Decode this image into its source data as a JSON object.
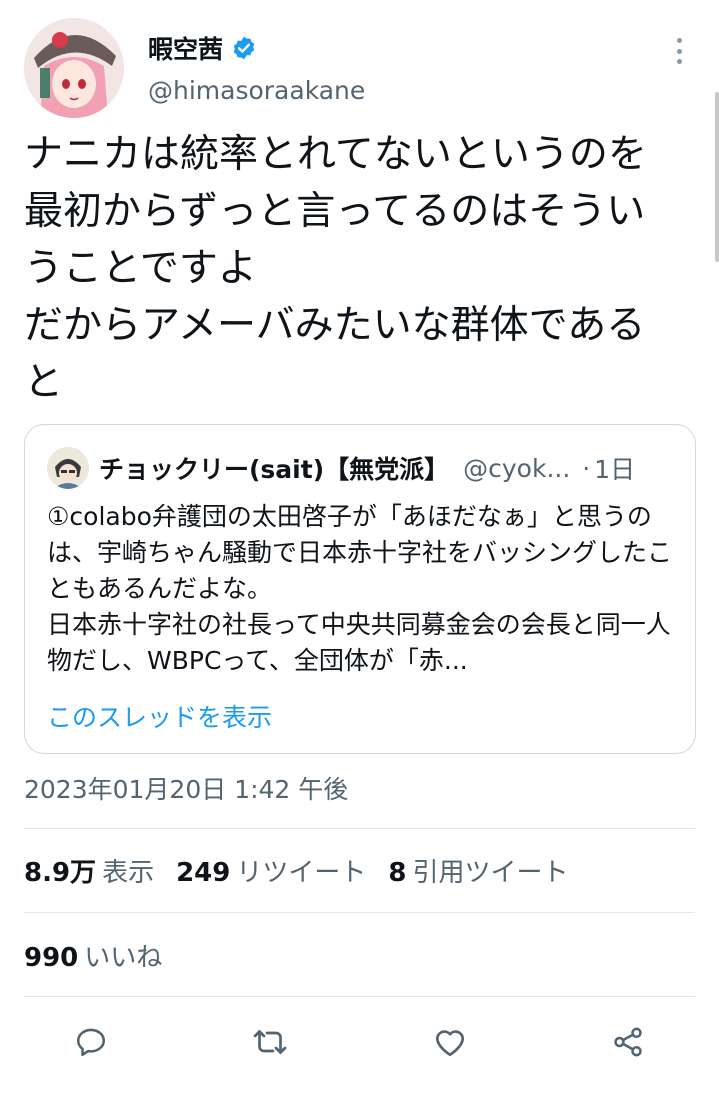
{
  "author": {
    "display_name": "暇空茜",
    "handle": "@himasoraakane",
    "verified_color": "#1d9bf0"
  },
  "tweet": {
    "text": "ナニカは統率とれてないというのを最初からずっと言ってるのはそういうことですよ\nだからアメーバみたいな群体であると"
  },
  "quote": {
    "author_name": "チョックリー(sait)【無党派】",
    "handle": "@cyok...",
    "separator": "·",
    "time": "1日",
    "text": "①colabo弁護団の太田啓子が「あほだなぁ」と思うのは、宇崎ちゃん騒動で日本赤十字社をバッシングしたこともあるんだよな。\n日本赤十字社の社長って中央共同募金会の会長と同一人物だし、WBPCって、全団体が「赤...",
    "thread_link": "このスレッドを表示"
  },
  "timestamp": "2023年01月20日 1:42 午後",
  "stats": {
    "views_count": "8.9万",
    "views_label": "表示",
    "retweets_count": "249",
    "retweets_label": "リツイート",
    "quotes_count": "8",
    "quotes_label": "引用ツイート",
    "likes_count": "990",
    "likes_label": "いいね"
  },
  "actions": [
    "reply-icon",
    "retweet-icon",
    "like-icon",
    "share-icon"
  ],
  "colors": {
    "text": "#0f1419",
    "secondary": "#536471",
    "link": "#1d9bf0",
    "border": "#cfd9de"
  }
}
